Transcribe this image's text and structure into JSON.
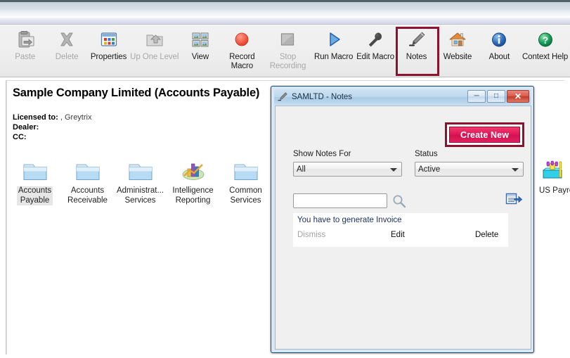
{
  "toolbar": {
    "items": [
      {
        "label": "Paste",
        "icon": "paste-icon",
        "disabled": true
      },
      {
        "label": "Delete",
        "icon": "delete-icon",
        "disabled": true
      },
      {
        "label": "Properties",
        "icon": "properties-icon",
        "disabled": false
      },
      {
        "label": "Up One Level",
        "icon": "up-one-level-icon",
        "disabled": true
      },
      {
        "label": "View",
        "icon": "view-icon",
        "disabled": false
      },
      {
        "label": "Record Macro",
        "icon": "record-macro-icon",
        "disabled": false
      },
      {
        "label": "Stop Recording",
        "icon": "stop-recording-icon",
        "disabled": true
      },
      {
        "label": "Run Macro",
        "icon": "run-macro-icon",
        "disabled": false
      },
      {
        "label": "Edit Macro",
        "icon": "edit-macro-icon",
        "disabled": false
      },
      {
        "label": "Notes",
        "icon": "notes-pencil-icon",
        "disabled": false,
        "highlighted": true
      },
      {
        "label": "Website",
        "icon": "website-home-icon",
        "disabled": false
      },
      {
        "label": "About",
        "icon": "about-info-icon",
        "disabled": false
      },
      {
        "label": "Context Help",
        "icon": "context-help-icon",
        "disabled": false
      }
    ],
    "highlight_color": "#8c1230"
  },
  "desktop": {
    "company_title": "Sample Company Limited (Accounts Payable)",
    "licensed_to_label": "Licensed to:",
    "licensed_to_value": ", Greytrix",
    "dealer_label": "Dealer:",
    "dealer_value": "",
    "cc_label": "CC:",
    "cc_value": "",
    "folders": [
      {
        "label_line1": "Accounts",
        "label_line2": "Payable",
        "icon": "folder-icon",
        "selected": true
      },
      {
        "label_line1": "Accounts",
        "label_line2": "Receivable",
        "icon": "folder-icon",
        "selected": false
      },
      {
        "label_line1": "Administrat...",
        "label_line2": "Services",
        "icon": "folder-icon",
        "selected": false
      },
      {
        "label_line1": "Intelligence",
        "label_line2": "Reporting",
        "icon": "chart-folder-icon",
        "selected": false
      },
      {
        "label_line1": "Common",
        "label_line2": "Services",
        "icon": "folder-icon",
        "selected": false
      }
    ],
    "far_folder": {
      "label": "US Payro",
      "icon": "us-payroll-icon"
    }
  },
  "dialog": {
    "title": "SAMLTD - Notes",
    "title_icon": "pencil-icon",
    "minimize_glyph": "─",
    "maximize_glyph": "□",
    "close_glyph": "✕",
    "create_new_label": "Create New",
    "create_new_color": "#e4175a",
    "highlight_color": "#8c1230",
    "show_notes_for_label": "Show Notes For",
    "show_notes_for_value": "All",
    "status_label": "Status",
    "status_value": "Active",
    "search_value": "",
    "search_placeholder": "",
    "search_icon": "magnifier-icon",
    "export_icon": "grid-export-icon",
    "notes": [
      {
        "text": "You have to generate Invoice",
        "dismiss_label": "Dismiss",
        "edit_label": "Edit",
        "delete_label": "Delete",
        "dismiss_disabled": true
      }
    ]
  }
}
